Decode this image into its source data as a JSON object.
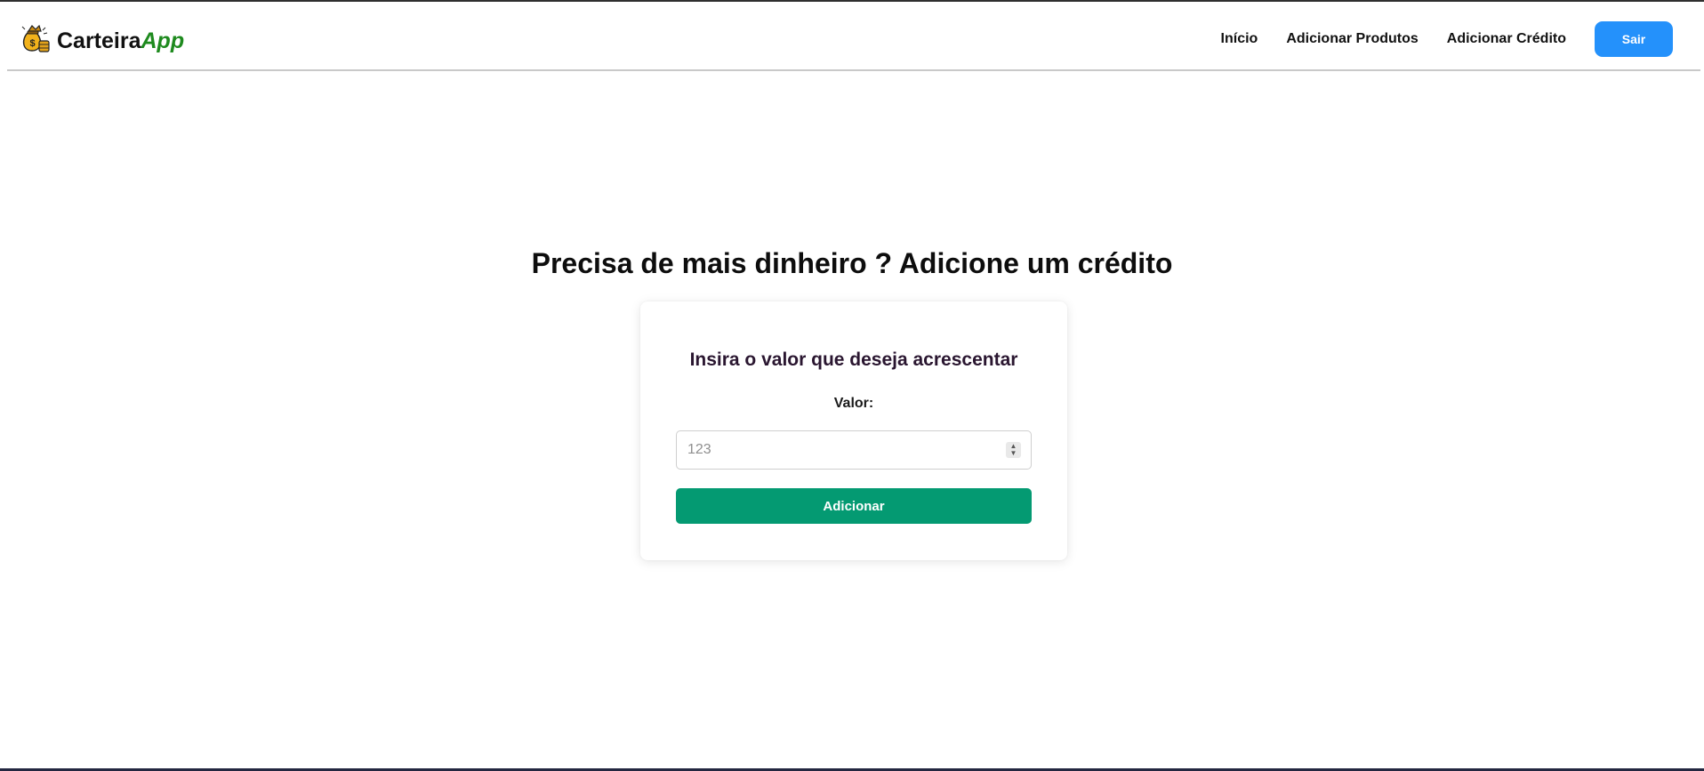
{
  "header": {
    "brand_text": "Carteira",
    "brand_accent": "App",
    "logo_icon": "money-bag-icon",
    "nav": {
      "home_label": "Início",
      "add_products_label": "Adicionar Produtos",
      "add_credit_label": "Adicionar Crédito"
    },
    "logout_label": "Sair"
  },
  "main": {
    "title": "Precisa de mais dinheiro ? Adicione um crédito",
    "card": {
      "title": "Insira o valor que deseja acrescentar",
      "field_label": "Valor:",
      "input_placeholder": "123",
      "input_value": "",
      "submit_label": "Adicionar"
    }
  },
  "colors": {
    "brand_accent": "#1e8a1e",
    "logout_button": "#2491fb",
    "submit_button": "#049a72"
  }
}
